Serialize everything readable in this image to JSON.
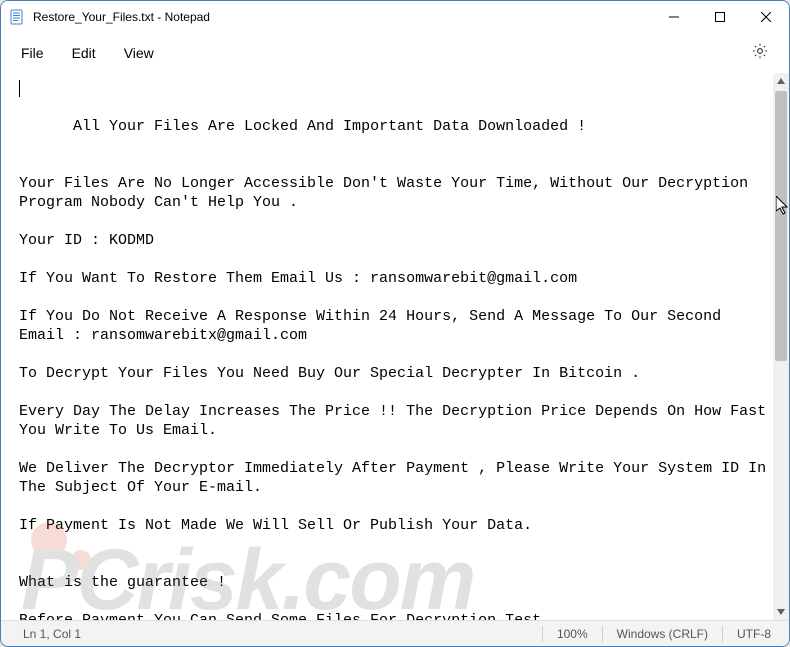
{
  "titlebar": {
    "title": "Restore_Your_Files.txt - Notepad"
  },
  "menu": {
    "file": "File",
    "edit": "Edit",
    "view": "View"
  },
  "document": {
    "text": "All Your Files Are Locked And Important Data Downloaded !\n\n\nYour Files Are No Longer Accessible Don't Waste Your Time, Without Our Decryption Program Nobody Can't Help You .\n\nYour ID : KODMD\n\nIf You Want To Restore Them Email Us : ransomwarebit@gmail.com\n\nIf You Do Not Receive A Response Within 24 Hours, Send A Message To Our Second Email : ransomwarebitx@gmail.com\n\nTo Decrypt Your Files You Need Buy Our Special Decrypter In Bitcoin .\n\nEvery Day The Delay Increases The Price !! The Decryption Price Depends On How Fast You Write To Us Email.\n\nWe Deliver The Decryptor Immediately After Payment , Please Write Your System ID In The Subject Of Your E-mail.\n\nIf Payment Is Not Made We Will Sell Or Publish Your Data.\n\n\nWhat is the guarantee !\n\nBefore Payment You Can Send Some Files For Decryption Test."
  },
  "statusbar": {
    "position": "Ln 1, Col 1",
    "zoom": "100%",
    "line_ending": "Windows (CRLF)",
    "encoding": "UTF-8"
  },
  "watermark": {
    "text": "PCrisk.com"
  }
}
